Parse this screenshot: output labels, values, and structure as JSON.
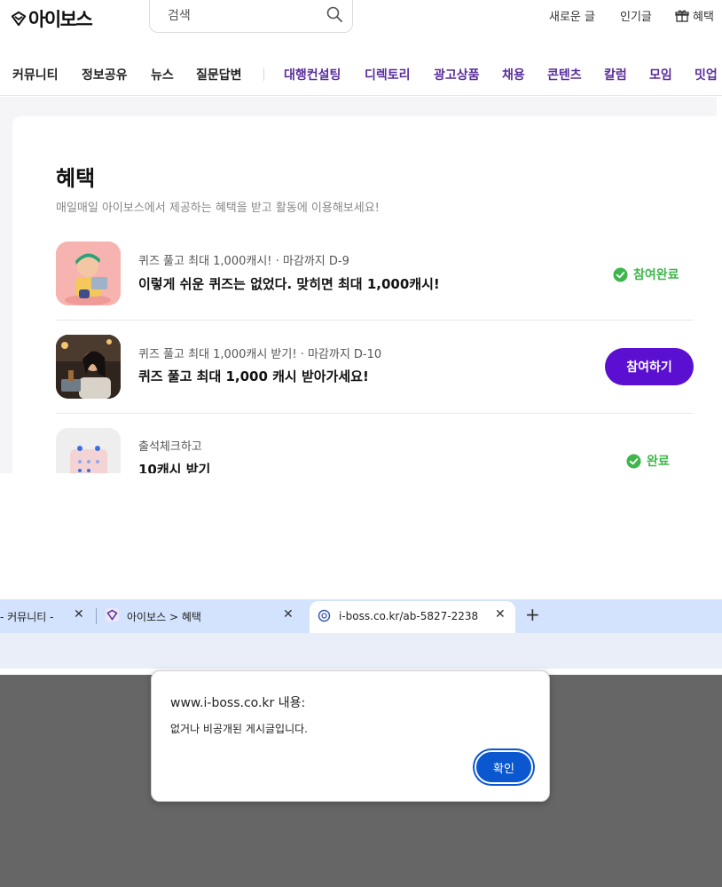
{
  "header": {
    "logo_text": "아이보스",
    "search_placeholder": "검색",
    "links": {
      "new_posts": "새로운 글",
      "popular": "인기글",
      "benefits": "혜택"
    }
  },
  "nav": {
    "left": [
      "커뮤니티",
      "정보공유",
      "뉴스",
      "질문답변"
    ],
    "right": [
      "대행컨설팅",
      "디렉토리",
      "광고상품",
      "채용",
      "콘텐츠",
      "칼럼",
      "모임",
      "밋업"
    ]
  },
  "page": {
    "title": "혜택",
    "subtitle": "매일매일 아이보스에서 제공하는 혜택을 받고 활동에 이용해보세요!"
  },
  "benefits": [
    {
      "meta": "퀴즈 풀고 최대 1,000캐시! · 마감까지 D-9",
      "title": "이렇게 쉬운 퀴즈는 없었다. 맞히면 최대 1,000캐시!",
      "status": "참여완료"
    },
    {
      "meta": "퀴즈 풀고 최대 1,000캐시 받기! · 마감까지 D-10",
      "title": "퀴즈 풀고 최대 1,000 캐시 받아가세요!",
      "button": "참여하기"
    },
    {
      "meta": "출석체크하고",
      "title": "10캐시 받기",
      "status": "완료"
    }
  ],
  "browser": {
    "tabs": [
      {
        "title": "- 커뮤니티 -"
      },
      {
        "title": "아이보스 > 혜택"
      },
      {
        "title": "i-boss.co.kr/ab-5827-2238"
      }
    ],
    "new_tab": "+",
    "close_glyph": "✕"
  },
  "dialog": {
    "title": "www.i-boss.co.kr 내용:",
    "message": "없거나 비공개된 게시글입니다.",
    "ok_label": "확인"
  },
  "colors": {
    "accent_purple": "#5a0fd1",
    "nav_purple": "#5a2d9c",
    "status_green": "#3fb64b",
    "dialog_blue": "#0b57d0"
  }
}
